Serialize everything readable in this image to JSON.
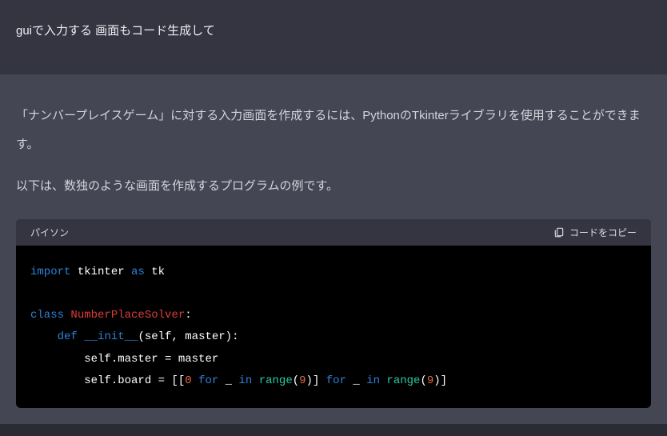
{
  "user": {
    "text": "guiで入力する 画面もコード生成して"
  },
  "assistant": {
    "paragraph1": "「ナンバープレイスゲーム」に対する入力画面を作成するには、PythonのTkinterライブラリを使用することができます。",
    "paragraph2": "以下は、数独のような画面を作成するプログラムの例です。"
  },
  "codeblock": {
    "language": "パイソン",
    "copy_label": "コードをコピー",
    "tokens": {
      "kw_import": "import",
      "tkinter": " tkinter ",
      "kw_as": "as",
      "tk": " tk",
      "kw_class": "class",
      "sp1": " ",
      "classname": "NumberPlaceSolver",
      "colon1": ":",
      "indent1": "    ",
      "kw_def": "def",
      "sp2": " ",
      "init": "__init__",
      "params": "(self, master):",
      "indent2": "        ",
      "line3": "self.master = master",
      "line4a": "self.board = [[",
      "num0a": "0",
      "line4b": " ",
      "kw_for1": "for",
      "line4c": " _ ",
      "kw_in1": "in",
      "line4d": " ",
      "range1": "range",
      "paren1a": "(",
      "num9a": "9",
      "paren1b": ")] ",
      "kw_for2": "for",
      "line4e": " _ ",
      "kw_in2": "in",
      "line4f": " ",
      "range2": "range",
      "paren2a": "(",
      "num9b": "9",
      "paren2b": ")]"
    }
  }
}
